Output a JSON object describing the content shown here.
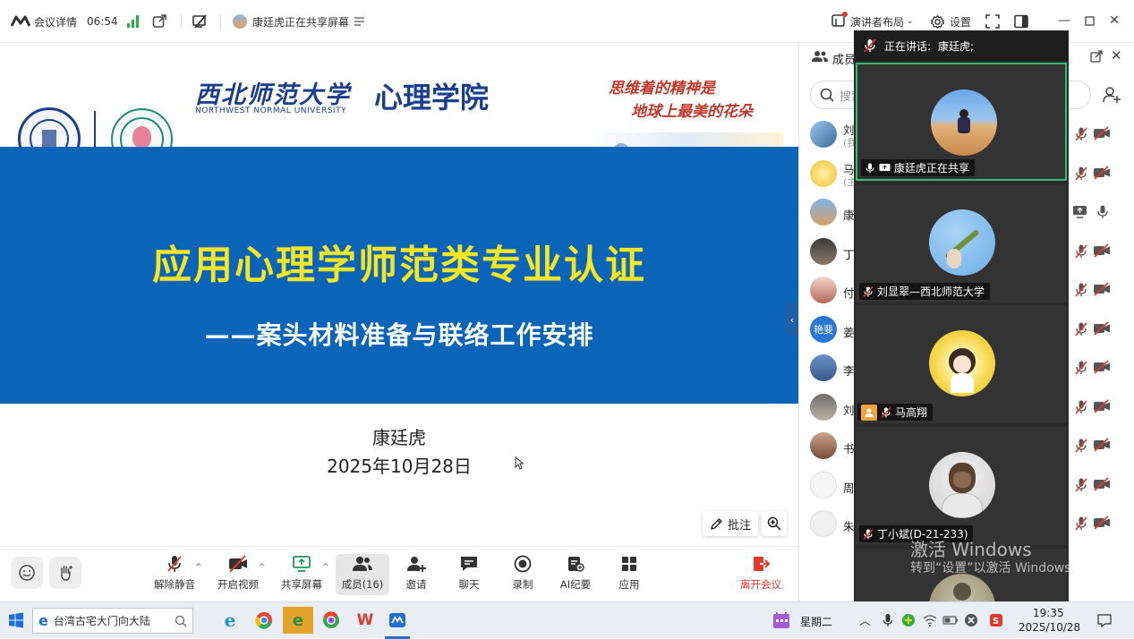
{
  "topbar": {
    "meeting_info": "会议详情",
    "duration": "06:54",
    "sharing_status": "康廷虎正在共享屏幕",
    "layout_label": "演讲者布局",
    "settings_label": "设置"
  },
  "slide": {
    "university_cn": "西北师范大学",
    "university_en": "NORTHWEST NORMAL UNIVERSITY",
    "college": "心理学院",
    "slogan_line1": "思维着的精神是",
    "slogan_line2": "地球上最美的花朵",
    "title": "应用心理学师范类专业认证",
    "subtitle": "——案头材料准备与联络工作安排",
    "presenter": "康廷虎",
    "date": "2025年10月28日"
  },
  "share_controls": {
    "annotate_label": "批注"
  },
  "toolbar": {
    "unmute": "解除静音",
    "start_video": "开启视频",
    "share_screen": "共享屏幕",
    "members": "成员(16)",
    "invite": "邀请",
    "chat": "聊天",
    "record": "录制",
    "ai_summary": "AI纪要",
    "apps": "应用",
    "leave": "离开会议"
  },
  "panel": {
    "title": "成员",
    "search_placeholder": "搜索",
    "members": [
      {
        "name": "刘",
        "sub": "(我"
      },
      {
        "name": "马",
        "sub": "(主"
      },
      {
        "name": "康",
        "sub": ""
      },
      {
        "name": "丁",
        "sub": ""
      },
      {
        "name": "付",
        "sub": ""
      },
      {
        "name": "姜",
        "sub": "",
        "avatar_text": "艳斐"
      },
      {
        "name": "李",
        "sub": ""
      },
      {
        "name": "刘",
        "sub": ""
      },
      {
        "name": "书",
        "sub": ""
      },
      {
        "name": "周",
        "sub": ""
      },
      {
        "name": "朱",
        "sub": ""
      }
    ]
  },
  "videos": {
    "speaking_prefix": "正在讲话:",
    "speaking_name": "康廷虎;",
    "tiles": [
      {
        "label": "康廷虎正在共享"
      },
      {
        "label": "刘显翠—西北师范大学"
      },
      {
        "label": "马高翔"
      },
      {
        "label": "丁小斌(D-21-233)"
      }
    ]
  },
  "watermark": {
    "line1": "激活 Windows",
    "line2": "转到“设置”以激活 Windows。"
  },
  "taskbar": {
    "search_text": "台湾古宅大门向大陆",
    "weekday": "星期二",
    "time": "19:35",
    "date": "2025/10/28"
  },
  "colors": {
    "slide_blue": "#0a64b7",
    "title_yellow": "#f5e625",
    "leave_red": "#e0382b",
    "speaking_green": "#2fbf71"
  }
}
